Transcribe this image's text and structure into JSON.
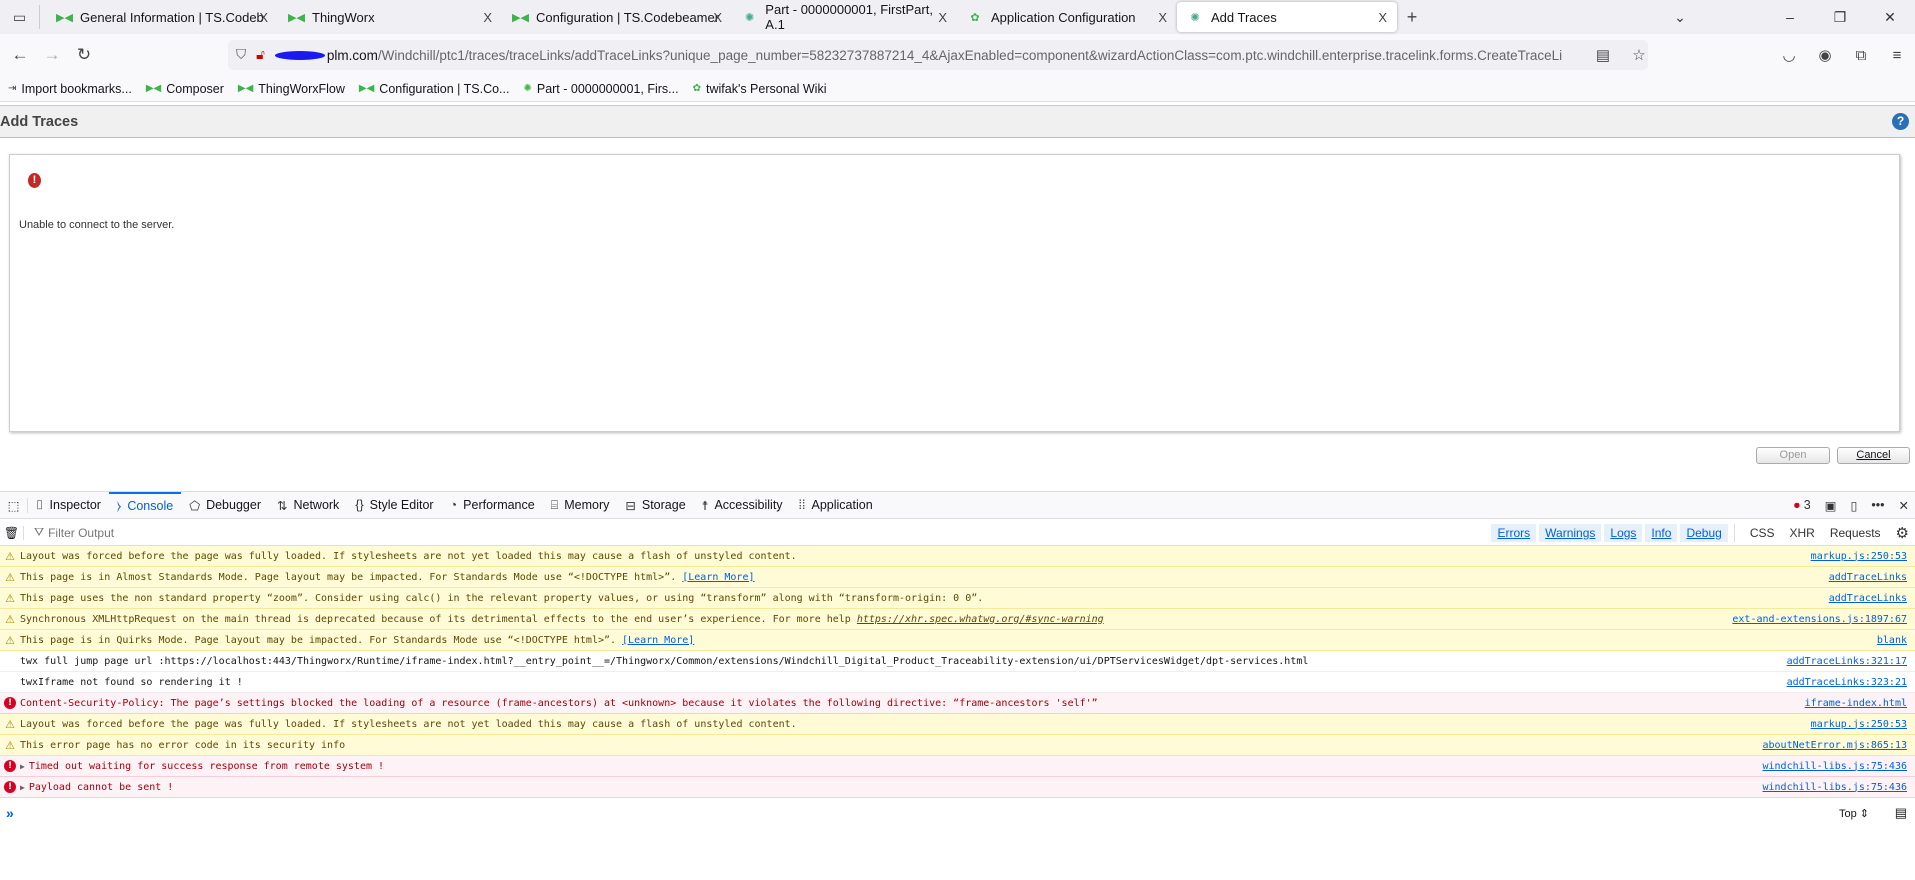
{
  "browser": {
    "tabs": [
      {
        "label": "General Information | TS.Codeb",
        "icon": "thingworx-icon",
        "active": false
      },
      {
        "label": "ThingWorx",
        "icon": "thingworx-icon",
        "active": false
      },
      {
        "label": "Configuration | TS.Codebeamer",
        "icon": "thingworx-icon",
        "active": false
      },
      {
        "label": "Part - 0000000001, FirstPart, A.1",
        "icon": "windchill-icon",
        "active": false
      },
      {
        "label": "Application Configuration",
        "icon": "codebeamer-icon",
        "active": false
      },
      {
        "label": "Add Traces",
        "icon": "windchill-icon",
        "active": true
      }
    ],
    "close_glyph": "X",
    "url_host": "plm.com",
    "url_path": "/Windchill/ptc1/traces/traceLinks/addTraceLinks?unique_page_number=58232737887214_4&AjaxEnabled=component&wizardActionClass=com.ptc.windchill.enterprise.tracelink.forms.CreateTraceLi",
    "bookmarks": [
      "Import bookmarks...",
      "Composer",
      "ThingWorxFlow",
      "Configuration | TS.Co...",
      "Part - 0000000001, Firs...",
      "twifak's Personal Wiki"
    ]
  },
  "page": {
    "title": "Add Traces",
    "help": "?",
    "error_message": "Unable to connect to the server.",
    "open_label": "Open",
    "cancel_label": "Cancel"
  },
  "devtools": {
    "tabs": [
      "Inspector",
      "Console",
      "Debugger",
      "Network",
      "Style Editor",
      "Performance",
      "Memory",
      "Storage",
      "Accessibility",
      "Application"
    ],
    "error_count": "3",
    "filter_placeholder": "Filter Output",
    "filters": [
      "Errors",
      "Warnings",
      "Logs",
      "Info",
      "Debug"
    ],
    "filters2": [
      "CSS",
      "XHR",
      "Requests"
    ],
    "context": "Top ⇕",
    "messages": [
      {
        "level": "warn",
        "text": "Layout was forced before the page was fully loaded. If stylesheets are not yet loaded this may cause a flash of unstyled content.",
        "source": "markup.js:250:53"
      },
      {
        "level": "warn",
        "text": "This page is in Almost Standards Mode. Page layout may be impacted. For Standards Mode use “<!DOCTYPE html>”.",
        "link": "[Learn More]",
        "source": "addTraceLinks"
      },
      {
        "level": "warn",
        "text": "This page uses the non standard property “zoom”. Consider using calc() in the relevant property values, or using “transform” along with “transform-origin: 0 0”.",
        "source": "addTraceLinks"
      },
      {
        "level": "warn",
        "text": "Synchronous XMLHttpRequest on the main thread is deprecated because of its detrimental effects to the end user’s experience. For more help",
        "link": "https://xhr.spec.whatwg.org/#sync-warning",
        "source": "ext-and-extensions.js:1897:67"
      },
      {
        "level": "warn",
        "text": "This page is in Quirks Mode. Page layout may be impacted. For Standards Mode use “<!DOCTYPE html>”.",
        "link": "[Learn More]",
        "source": "blank"
      },
      {
        "level": "log",
        "text": "twx full jump page  url  :https://localhost:443/Thingworx/Runtime/iframe-index.html?__entry_point__=/Thingworx/Common/extensions/Windchill_Digital_Product_Traceability-extension/ui/DPTServicesWidget/dpt-services.html",
        "source": "addTraceLinks:321:17"
      },
      {
        "level": "log",
        "text": "twxIframe not found so rendering it !",
        "source": "addTraceLinks:323:21"
      },
      {
        "level": "error",
        "text": "Content-Security-Policy: The page’s settings blocked the loading of a resource (frame-ancestors) at <unknown> because it violates the following directive: “frame-ancestors 'self'”",
        "source": "iframe-index.html"
      },
      {
        "level": "warn",
        "text": "Layout was forced before the page was fully loaded. If stylesheets are not yet loaded this may cause a flash of unstyled content.",
        "source": "markup.js:250:53"
      },
      {
        "level": "warn",
        "text": "This error page has no error code in its security info",
        "source": "aboutNetError.mjs:865:13"
      },
      {
        "level": "error",
        "expandable": true,
        "text": "Timed out waiting for success response from remote system !",
        "source": "windchill-libs.js:75:436"
      },
      {
        "level": "error",
        "expandable": true,
        "text": "Payload cannot be sent !",
        "source": "windchill-libs.js:75:436"
      }
    ]
  }
}
